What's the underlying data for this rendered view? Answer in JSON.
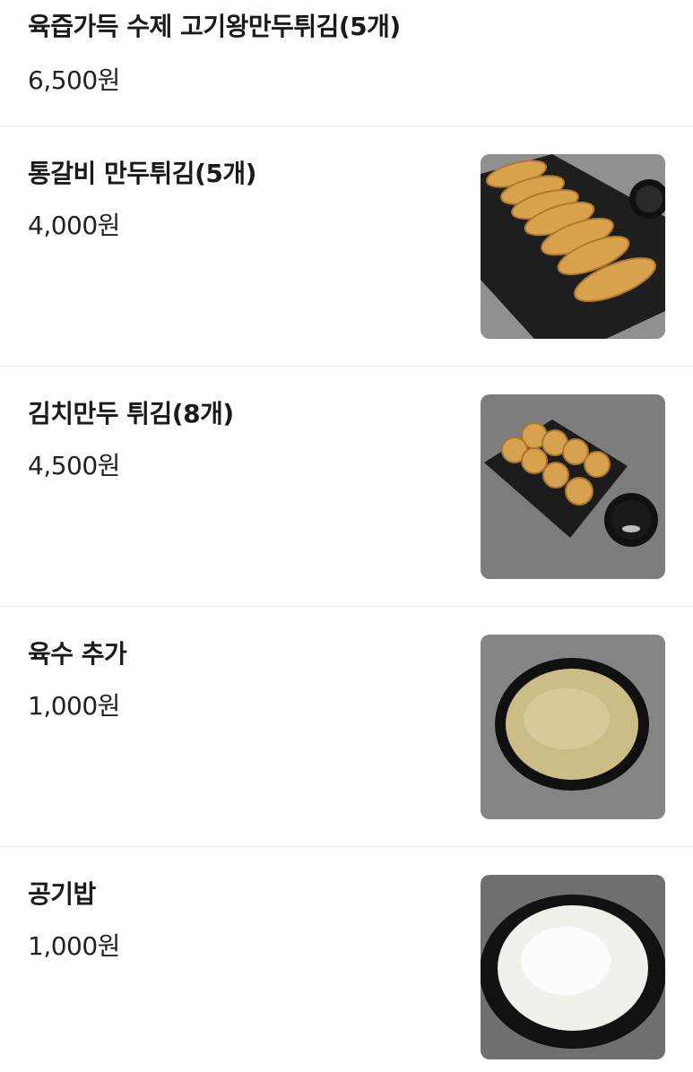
{
  "menu": {
    "items": [
      {
        "name": "육즙가득 수제 고기왕만두튀김(5개)",
        "price": "6,500원",
        "image": "none"
      },
      {
        "name": "통갈비 만두튀김(5개)",
        "price": "4,000원",
        "image": "fried-dumplings-on-black-tray-photo"
      },
      {
        "name": "김치만두 튀김(8개)",
        "price": "4,500원",
        "image": "kimchi-dumplings-with-dipping-sauce-photo"
      },
      {
        "name": "육수 추가",
        "price": "1,000원",
        "image": "broth-bowl-photo"
      },
      {
        "name": "공기밥",
        "price": "1,000원",
        "image": "rice-bowl-photo"
      }
    ]
  }
}
